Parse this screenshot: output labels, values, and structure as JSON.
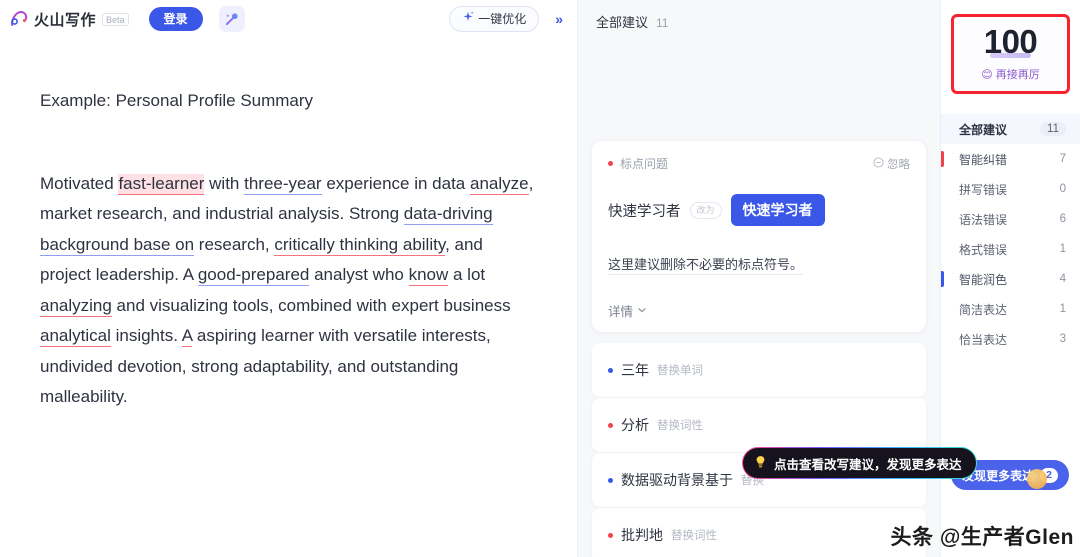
{
  "header": {
    "brand_name": "火山写作",
    "beta_label": "Beta",
    "login_label": "登录",
    "magic_icon": "magic-wand-icon",
    "optimize_label": "一键优化",
    "optimize_icon": "sparkle-icon",
    "collapse_label": "»"
  },
  "document": {
    "title": "Example: Personal Profile Summary",
    "body_segments": [
      {
        "text": "Motivated ",
        "style": "plain"
      },
      {
        "text": "fast-learner",
        "style": "hl-red"
      },
      {
        "text": " with ",
        "style": "plain"
      },
      {
        "text": "three-year",
        "style": "u-blue"
      },
      {
        "text": " experience in data ",
        "style": "plain"
      },
      {
        "text": "analyze",
        "style": "u-red"
      },
      {
        "text": ", market research, and industrial analysis. Strong ",
        "style": "plain"
      },
      {
        "text": "data-driving background base on",
        "style": "u-blue"
      },
      {
        "text": " research, ",
        "style": "plain"
      },
      {
        "text": "critically thinking ability",
        "style": "u-red"
      },
      {
        "text": ", and project leadership. A ",
        "style": "plain"
      },
      {
        "text": "good-prepared",
        "style": "u-blue"
      },
      {
        "text": " analyst who ",
        "style": "plain"
      },
      {
        "text": "know",
        "style": "u-red"
      },
      {
        "text": " a lot ",
        "style": "plain"
      },
      {
        "text": "analyzing",
        "style": "u-red"
      },
      {
        "text": " and visualizing tools, combined with expert business ",
        "style": "plain"
      },
      {
        "text": "analytical",
        "style": "u-red"
      },
      {
        "text": " insights. ",
        "style": "plain"
      },
      {
        "text": "A",
        "style": "u-red"
      },
      {
        "text": " aspiring learner with versatile interests, undivided devotion, strong adaptability, and outstanding malleability.",
        "style": "plain"
      }
    ]
  },
  "suggestions": {
    "header_title": "全部建议",
    "header_count": "11",
    "card": {
      "tag": "标点问题",
      "tag_dot": "red",
      "ignore_label": "忽略",
      "ignore_icon": "minus-circle-icon",
      "original_text": "快速学习者",
      "arrow_label": "改为",
      "suggested_text": "快速学习者",
      "description": "这里建议删除不必要的标点符号。",
      "more_label": "详情",
      "more_icon": "chevron-down-icon"
    },
    "items": [
      {
        "word": "三年",
        "kind": "替换单词",
        "dot": "blue"
      },
      {
        "word": "分析",
        "kind": "替换词性",
        "dot": "red"
      },
      {
        "word": "数据驱动背景基于",
        "kind": "替换",
        "dot": "blue"
      },
      {
        "word": "批判地",
        "kind": "替换词性",
        "dot": "red"
      }
    ]
  },
  "tooltip": {
    "icon": "lightbulb-icon",
    "text": "点击查看改写建议，发现更多表达"
  },
  "sidebar": {
    "score": "100",
    "score_sub": "再接再厉",
    "score_emoji": "😊",
    "items": [
      {
        "label": "全部建议",
        "count": "11",
        "marker": "none",
        "active": true,
        "sub": false
      },
      {
        "label": "智能纠错",
        "count": "7",
        "marker": "red",
        "active": false,
        "sub": false
      },
      {
        "label": "拼写错误",
        "count": "0",
        "marker": "none",
        "active": false,
        "sub": true
      },
      {
        "label": "语法错误",
        "count": "6",
        "marker": "none",
        "active": false,
        "sub": true
      },
      {
        "label": "格式错误",
        "count": "1",
        "marker": "none",
        "active": false,
        "sub": true
      },
      {
        "label": "智能润色",
        "count": "4",
        "marker": "blue",
        "active": false,
        "sub": false
      },
      {
        "label": "简洁表达",
        "count": "1",
        "marker": "none",
        "active": false,
        "sub": true
      },
      {
        "label": "恰当表达",
        "count": "3",
        "marker": "none",
        "active": false,
        "sub": true
      }
    ],
    "discover_label": "发现更多表达",
    "discover_count": "2"
  },
  "watermark": "头条 @生产者Glen",
  "colors": {
    "accent_blue": "#3a57e8",
    "error_red": "#f0434f",
    "annotation_red": "#f5242e",
    "panel_bg": "#f7f8fa"
  }
}
